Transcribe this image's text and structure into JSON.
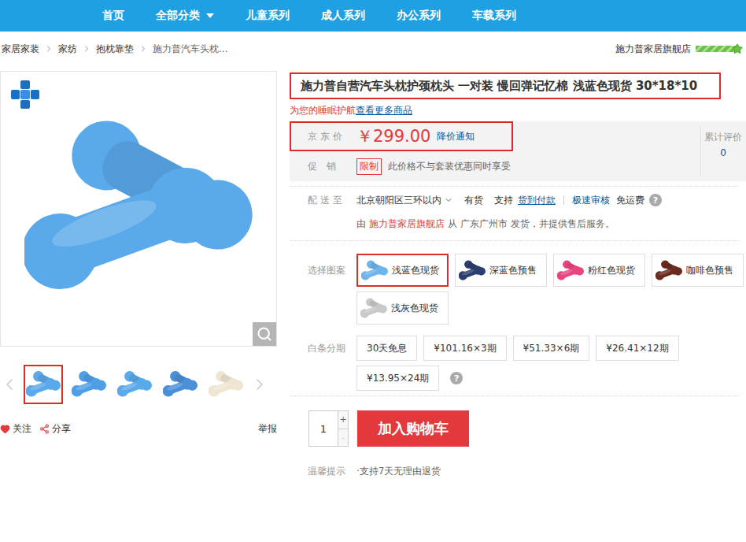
{
  "nav": [
    {
      "label": "首页",
      "dropdown": false
    },
    {
      "label": "全部分类",
      "dropdown": true
    },
    {
      "label": "儿童系列",
      "dropdown": false
    },
    {
      "label": "成人系列",
      "dropdown": false
    },
    {
      "label": "办公系列",
      "dropdown": false
    },
    {
      "label": "车载系列",
      "dropdown": false
    }
  ],
  "breadcrumb": [
    "家居家装",
    "家纺",
    "抱枕靠垫",
    "施力普汽车头枕..."
  ],
  "store": {
    "name": "施力普家居旗舰店",
    "level": 1
  },
  "gallery": {
    "main_color": "#5aa9ea",
    "thumbnails": [
      {
        "selected": true,
        "color": "#5aa9ea"
      },
      {
        "selected": false,
        "color": "#4f9fe6"
      },
      {
        "selected": false,
        "color": "#5aa9ea"
      },
      {
        "selected": false,
        "color": "#4a8fd8"
      },
      {
        "selected": false,
        "color": "#efe6d2"
      }
    ],
    "follow": "关注",
    "share": "分享",
    "report": "举报"
  },
  "product": {
    "title": "施力普自营汽车头枕护颈枕头 一对装 慢回弹记忆棉 浅蓝色现货 30*18*10",
    "highlighted": true,
    "slogan": "为您的睡眠护航",
    "slogan_link": "查看更多商品"
  },
  "price": {
    "label": "京 东 价",
    "value": "￥299.00",
    "alert": "降价通知",
    "highlighted": true,
    "reviews_label": "累计评价",
    "reviews_count": "0"
  },
  "promotion": {
    "label": "促　销",
    "tag": "限制",
    "text": "此价格不与套装优惠同时享受"
  },
  "delivery": {
    "label": "配 送 至",
    "area": "北京朝阳区三环以内",
    "stock": "有货",
    "support": "支持",
    "services": [
      "货到付款",
      "极速审核"
    ],
    "shipping": "免运费",
    "help": "?",
    "seller_prefix": "由",
    "seller": "施力普家居旗舰店",
    "seller_suffix": "从 广东广州市 发货，并提供售后服务。"
  },
  "pattern": {
    "label": "选择图案",
    "options": [
      {
        "label": "浅蓝色现货",
        "selected": true,
        "color": "#6fb4ea"
      },
      {
        "label": "深蓝色预售",
        "selected": false,
        "color": "#2c3e6e"
      },
      {
        "label": "粉红色现货",
        "selected": false,
        "color": "#e8457f"
      },
      {
        "label": "咖啡色预售",
        "selected": false,
        "color": "#6b2b1e"
      },
      {
        "label": "浅灰色现货",
        "selected": false,
        "color": "#c9c9c9"
      }
    ]
  },
  "installment": {
    "label": "白条分期",
    "options": [
      {
        "label": "30天免息",
        "selected": false
      },
      {
        "label": "¥101.16×3期",
        "selected": false
      },
      {
        "label": "¥51.33×6期",
        "selected": false
      },
      {
        "label": "¥26.41×12期",
        "selected": false
      },
      {
        "label": "¥13.95×24期",
        "selected": false
      }
    ],
    "help": "?"
  },
  "quantity": {
    "value": "1",
    "plus": "+",
    "minus": "-",
    "minus_disabled": true
  },
  "cart_button": "加入购物车",
  "tip": {
    "label": "温馨提示",
    "text": "·支持7天无理由退货"
  }
}
